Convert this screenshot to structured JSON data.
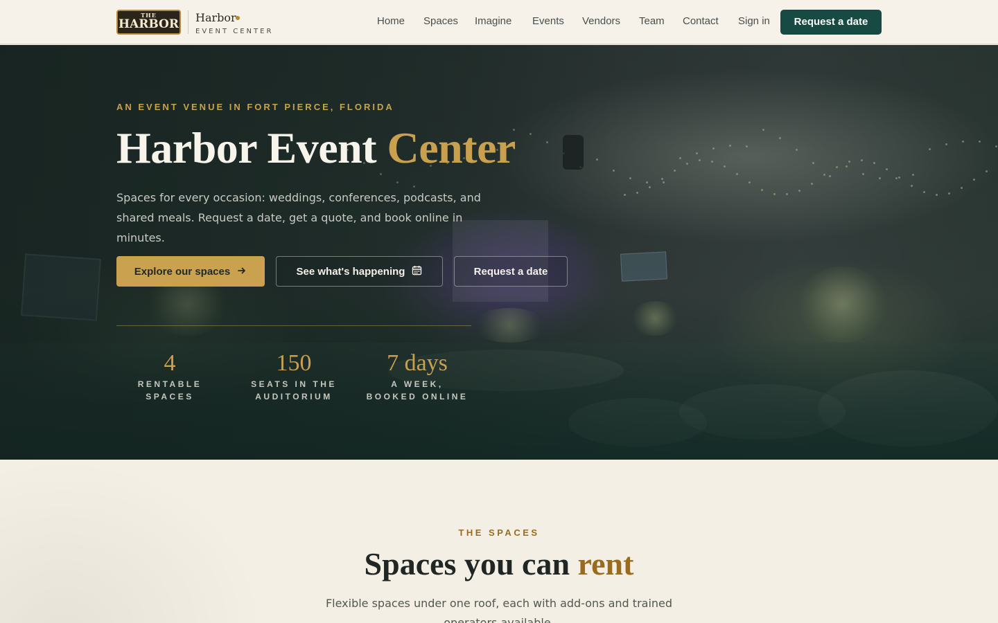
{
  "brand": {
    "logo_top": "THE",
    "logo_main": "HARBOR",
    "name": "Harbor",
    "subtitle": "EVENT CENTER"
  },
  "nav": {
    "links": [
      "Home",
      "Spaces",
      "Imagine",
      "Events",
      "Vendors",
      "Team",
      "Contact",
      "Sign in"
    ],
    "cta_label": "Request a date"
  },
  "hero": {
    "eyebrow": "AN EVENT VENUE IN FORT PIERCE, FLORIDA",
    "title_main": "Harbor Event",
    "title_accent": "Center",
    "description": "Spaces for every occasion: weddings, conferences, podcasts, and shared meals. Request a date, get a quote, and book online in minutes.",
    "buttons": {
      "explore": "Explore our spaces",
      "happening": "See what's happening",
      "request": "Request a date"
    },
    "stats": [
      {
        "value": "4",
        "label_line1": "RENTABLE",
        "label_line2": "SPACES"
      },
      {
        "value": "150",
        "label_line1": "SEATS IN THE",
        "label_line2": "AUDITORIUM"
      },
      {
        "value": "7 days",
        "label_line1": "A WEEK,",
        "label_line2": "BOOKED ONLINE"
      }
    ]
  },
  "spaces": {
    "eyebrow": "THE SPACES",
    "title_main": "Spaces you can",
    "title_accent": "rent",
    "description": "Flexible spaces under one roof, each with add-ons and trained operators available."
  },
  "icons": {
    "explore_arrow": "arrow-right-icon",
    "happening": "calendar-icon"
  },
  "colors": {
    "accent_gold": "#c9a14f",
    "brand_green": "#164a42",
    "cream": "#f4efe4"
  }
}
